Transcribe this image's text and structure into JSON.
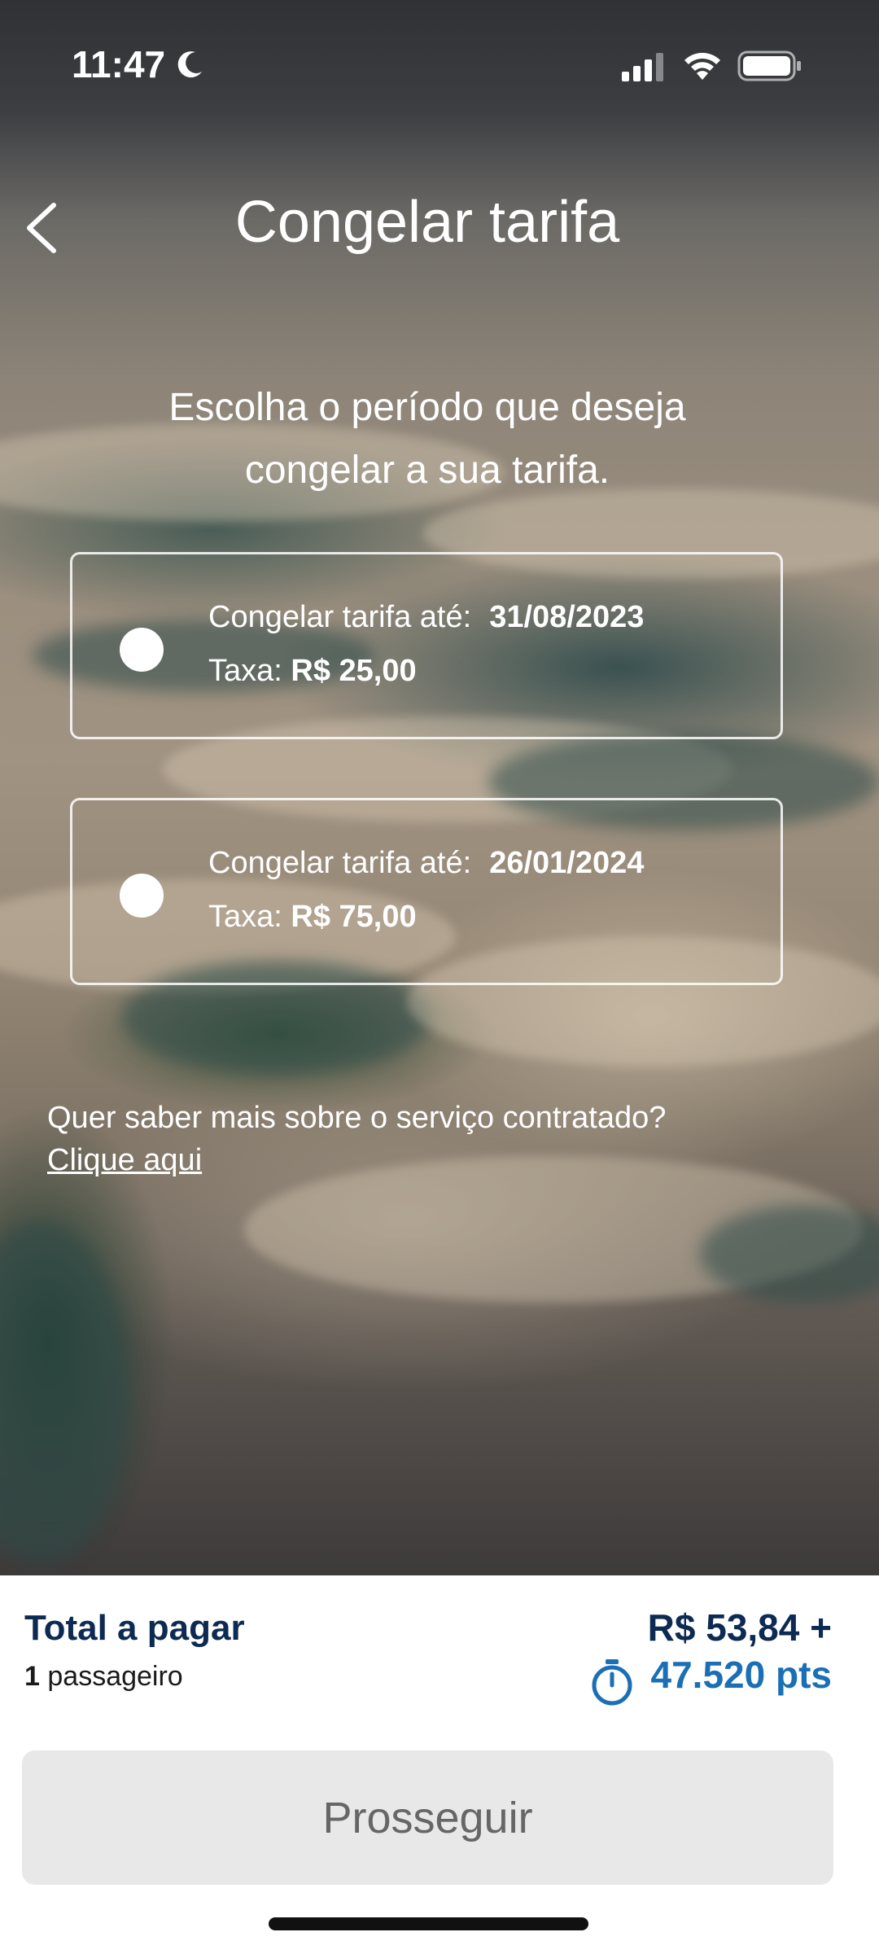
{
  "status_bar": {
    "time": "11:47"
  },
  "header": {
    "title": "Congelar tarifa"
  },
  "subtitle": "Escolha o período que deseja congelar a sua tarifa.",
  "options": [
    {
      "label": "Congelar tarifa até:",
      "date": "31/08/2023",
      "fee_label": "Taxa:",
      "fee": "R$ 25,00"
    },
    {
      "label": "Congelar tarifa até:",
      "date": "26/01/2024",
      "fee_label": "Taxa:",
      "fee": "R$ 75,00"
    }
  ],
  "info": {
    "question": "Quer saber mais sobre o serviço contratado?",
    "link": "Clique aqui"
  },
  "summary": {
    "total_label": "Total a pagar",
    "passenger_count": "1",
    "passenger_label": "passageiro",
    "price": "R$ 53,84 +",
    "points": "47.520 pts"
  },
  "footer": {
    "continue_label": "Prosseguir"
  },
  "colors": {
    "navy": "#0d2a52",
    "points_blue": "#1a6fb5",
    "button_bg": "#e8e8e8"
  }
}
